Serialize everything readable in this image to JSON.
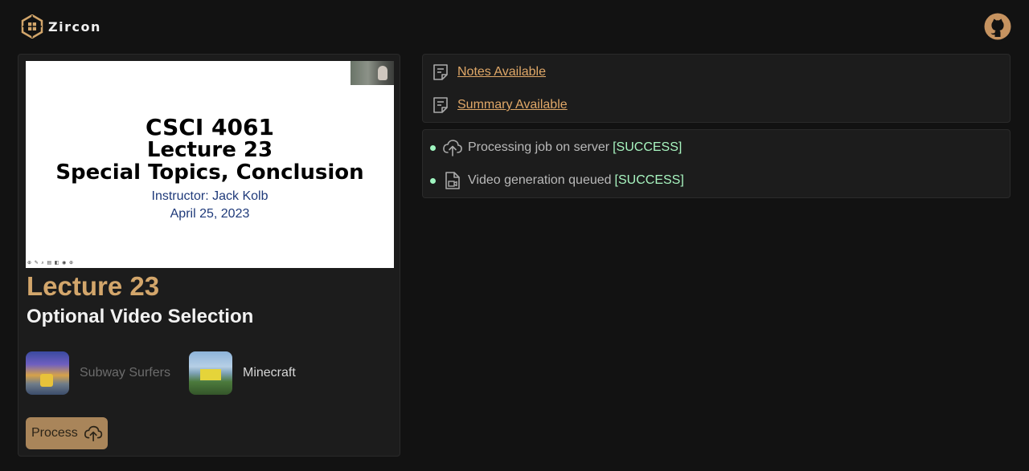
{
  "app": {
    "name": "Zircon"
  },
  "lecture": {
    "title": "Lecture 23",
    "slide": {
      "line1": "CSCI 4061",
      "line2": "Lecture 23",
      "line3": "Special Topics, Conclusion",
      "line4": "Instructor: Jack Kolb",
      "line5": "April 25, 2023"
    }
  },
  "video_selection": {
    "heading": "Optional Video Selection",
    "options": [
      {
        "label": "Subway Surfers",
        "selected": false
      },
      {
        "label": "Minecraft",
        "selected": true
      }
    ]
  },
  "process_button": {
    "label": "Process"
  },
  "documents": [
    {
      "label": "Notes Available"
    },
    {
      "label": "Summary Available"
    }
  ],
  "status": [
    {
      "text": "Processing job on server",
      "result": "[SUCCESS]"
    },
    {
      "text": "Video generation queued",
      "result": "[SUCCESS]"
    }
  ],
  "colors": {
    "accent": "#d3a66b",
    "success": "#a8f5c0",
    "button": "#a9855a"
  }
}
